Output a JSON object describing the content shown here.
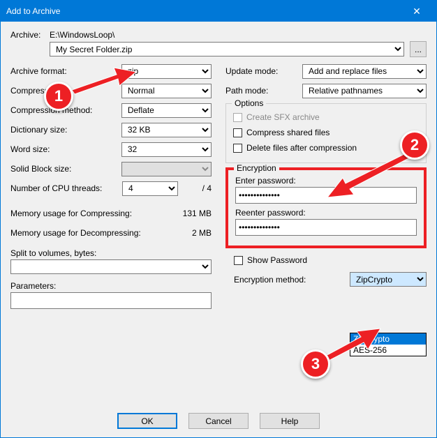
{
  "window": {
    "title": "Add to Archive"
  },
  "archive": {
    "label": "Archive:",
    "path": "E:\\WindowsLoop\\",
    "filename": "My Secret Folder.zip",
    "browse": "..."
  },
  "left": {
    "format_label": "Archive format:",
    "format_value": "zip",
    "level_label": "Compressi",
    "level_value": "Normal",
    "method_label": "Compression method:",
    "method_value": "Deflate",
    "dict_label": "Dictionary size:",
    "dict_value": "32 KB",
    "word_label": "Word size:",
    "word_value": "32",
    "solid_label": "Solid Block size:",
    "solid_value": "",
    "cpu_label": "Number of CPU threads:",
    "cpu_value": "4",
    "cpu_total": "/ 4",
    "mem_comp_label": "Memory usage for Compressing:",
    "mem_comp_value": "131 MB",
    "mem_decomp_label": "Memory usage for Decompressing:",
    "mem_decomp_value": "2 MB",
    "split_label": "Split to volumes, bytes:",
    "params_label": "Parameters:"
  },
  "right": {
    "update_label": "Update mode:",
    "update_value": "Add and replace files",
    "path_label": "Path mode:",
    "path_value": "Relative pathnames",
    "options_title": "Options",
    "opt_sfx": "Create SFX archive",
    "opt_shared": "Compress shared files",
    "opt_delete": "Delete files after compression",
    "enc_title": "Encryption",
    "enter_pw": "Enter password:",
    "reenter_pw": "Reenter password:",
    "pw_value": "••••••••••••••",
    "show_pw": "Show Password",
    "enc_method_label": "Encryption method:",
    "enc_method_value": "ZipCrypto",
    "enc_options": [
      "ZipCrypto",
      "AES-256"
    ]
  },
  "buttons": {
    "ok": "OK",
    "cancel": "Cancel",
    "help": "Help"
  },
  "annotations": {
    "b1": "1",
    "b2": "2",
    "b3": "3"
  }
}
